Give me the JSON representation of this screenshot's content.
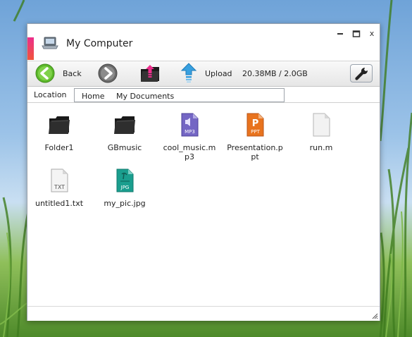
{
  "window": {
    "title": "My Computer",
    "controls": [
      "minimize",
      "maximize",
      "close"
    ],
    "close_glyph": "x"
  },
  "toolbar": {
    "back_label": "Back",
    "upload_label": "Upload",
    "storage_text": "20.38MB / 2.0GB",
    "icons": [
      "back-arrow-icon",
      "forward-arrow-icon",
      "download-folder-icon",
      "upload-arrow-icon",
      "wrench-icon"
    ]
  },
  "location": {
    "label": "Location",
    "crumbs": [
      "Home",
      "My Documents"
    ]
  },
  "files": [
    {
      "name": "Folder1",
      "type": "folder"
    },
    {
      "name": "GBmusic",
      "type": "folder"
    },
    {
      "name": "cool_music.mp3",
      "type": "mp3",
      "badge": "MP3"
    },
    {
      "name": "Presentation.ppt",
      "type": "ppt",
      "badge": "PPT"
    },
    {
      "name": "run.m",
      "type": "generic"
    },
    {
      "name": "untitled1.txt",
      "type": "txt",
      "badge": "TXT"
    },
    {
      "name": "my_pic.jpg",
      "type": "jpg",
      "badge": "JPG"
    }
  ],
  "colors": {
    "accent_strip": "#ec2e8c",
    "back_button": "#5cb82a",
    "upload_icon": "#38a0e0",
    "mp3_icon": "#6b5bb8",
    "ppt_icon": "#e8731e",
    "jpg_icon": "#1a9e8e"
  }
}
